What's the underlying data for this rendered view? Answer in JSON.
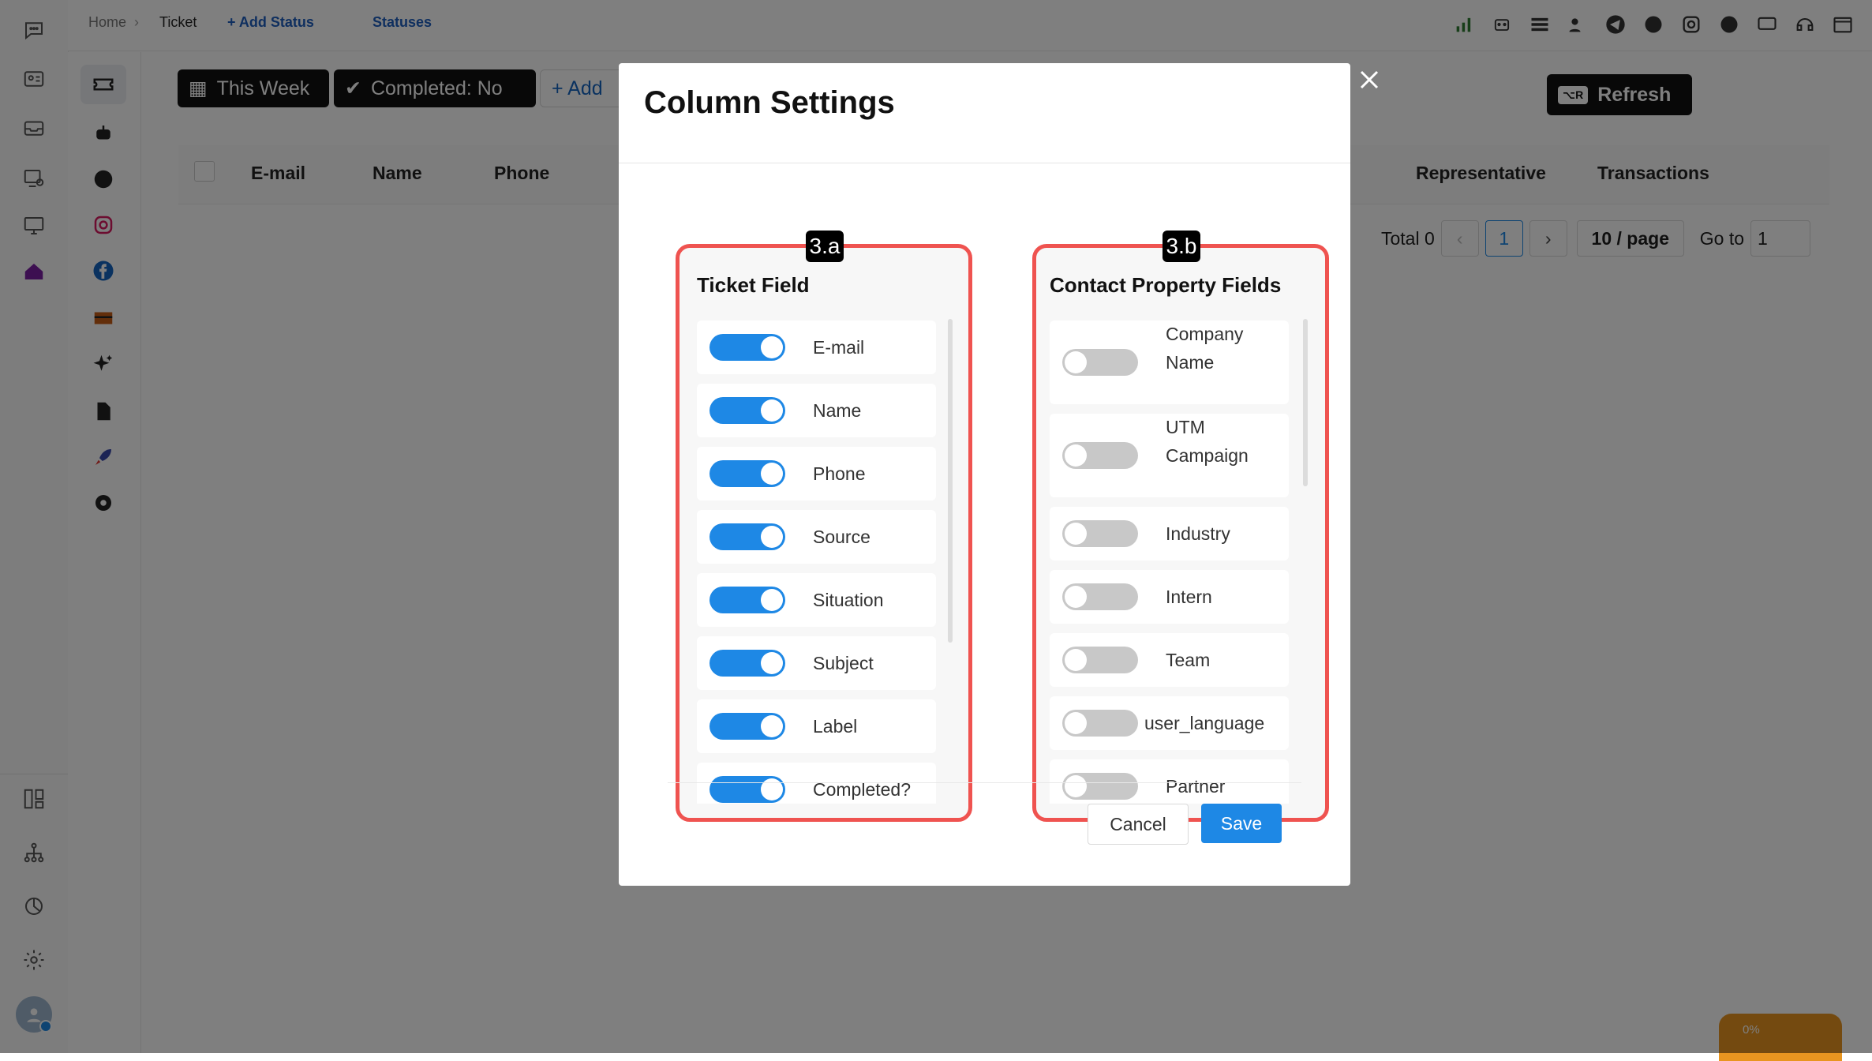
{
  "breadcrumb": {
    "home": "Home",
    "separator": "›",
    "current": "Ticket",
    "add_status": "+ Add Status",
    "statuses": "Statuses"
  },
  "toolbar": {
    "this_week": "This Week",
    "completed": "Completed: No",
    "add": "+ Add",
    "refresh": "Refresh",
    "refresh_key": "⌥R"
  },
  "table": {
    "columns": [
      "E-mail",
      "Name",
      "Phone",
      "Representative",
      "Transactions"
    ]
  },
  "pagination": {
    "total": "Total 0",
    "page": "1",
    "page_size": "10 / page",
    "goto_label": "Go to",
    "goto_value": "1"
  },
  "modal": {
    "title": "Column Settings",
    "ticket_panel": {
      "tag": "3.a",
      "title": "Ticket Field",
      "fields": [
        {
          "label": "E-mail",
          "on": true
        },
        {
          "label": "Name",
          "on": true
        },
        {
          "label": "Phone",
          "on": true
        },
        {
          "label": "Source",
          "on": true
        },
        {
          "label": "Situation",
          "on": true
        },
        {
          "label": "Subject",
          "on": true
        },
        {
          "label": "Label",
          "on": true
        },
        {
          "label": "Completed?",
          "on": true
        }
      ]
    },
    "contact_panel": {
      "tag": "3.b",
      "title": "Contact Property Fields",
      "fields": [
        {
          "label": "Company Name",
          "on": false
        },
        {
          "label": "UTM Campaign",
          "on": false
        },
        {
          "label": "Industry",
          "on": false
        },
        {
          "label": "Intern",
          "on": false
        },
        {
          "label": "Team",
          "on": false
        },
        {
          "label": "user_language",
          "on": false
        },
        {
          "label": "Partner",
          "on": false
        }
      ]
    },
    "cancel": "Cancel",
    "save": "Save"
  },
  "chat_widget": {
    "percent": "0%"
  },
  "colors": {
    "primary": "#1e88e5",
    "highlight": "#ef5350",
    "toggle_off": "#c8c8c8"
  }
}
